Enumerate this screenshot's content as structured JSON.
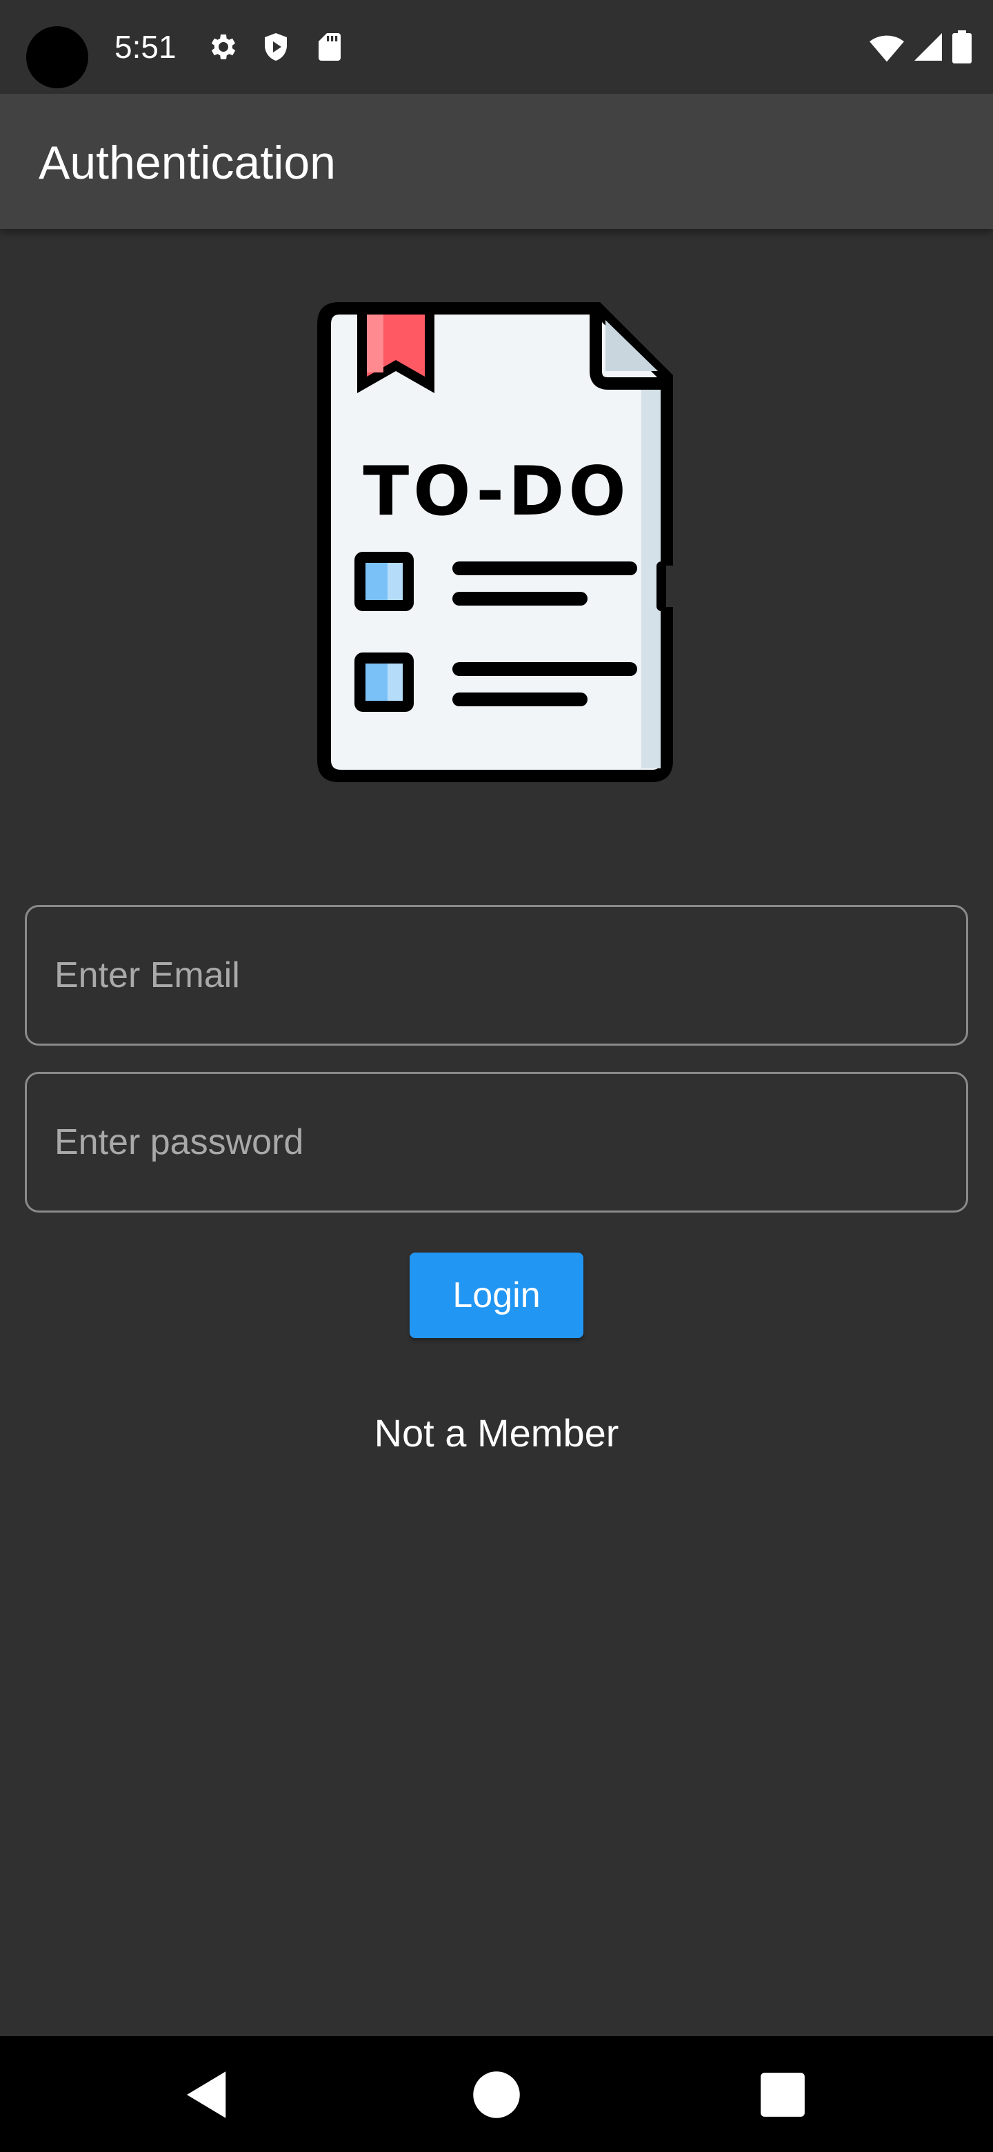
{
  "status_bar": {
    "time": "5:51",
    "icons": [
      "gear-icon",
      "shield-icon",
      "sd-card-icon",
      "wifi-icon",
      "signal-icon",
      "battery-icon"
    ]
  },
  "app_bar": {
    "title": "Authentication"
  },
  "logo": {
    "text": "TO-DO"
  },
  "form": {
    "email_placeholder": "Enter Email",
    "email_value": "",
    "password_placeholder": "Enter password",
    "password_value": "",
    "login_label": "Login",
    "not_member_label": "Not a Member"
  },
  "nav_bar": {
    "buttons": [
      "back-icon",
      "home-icon",
      "recents-icon"
    ]
  },
  "colors": {
    "background": "#303030",
    "app_bar": "#424242",
    "accent": "#2196f3"
  }
}
